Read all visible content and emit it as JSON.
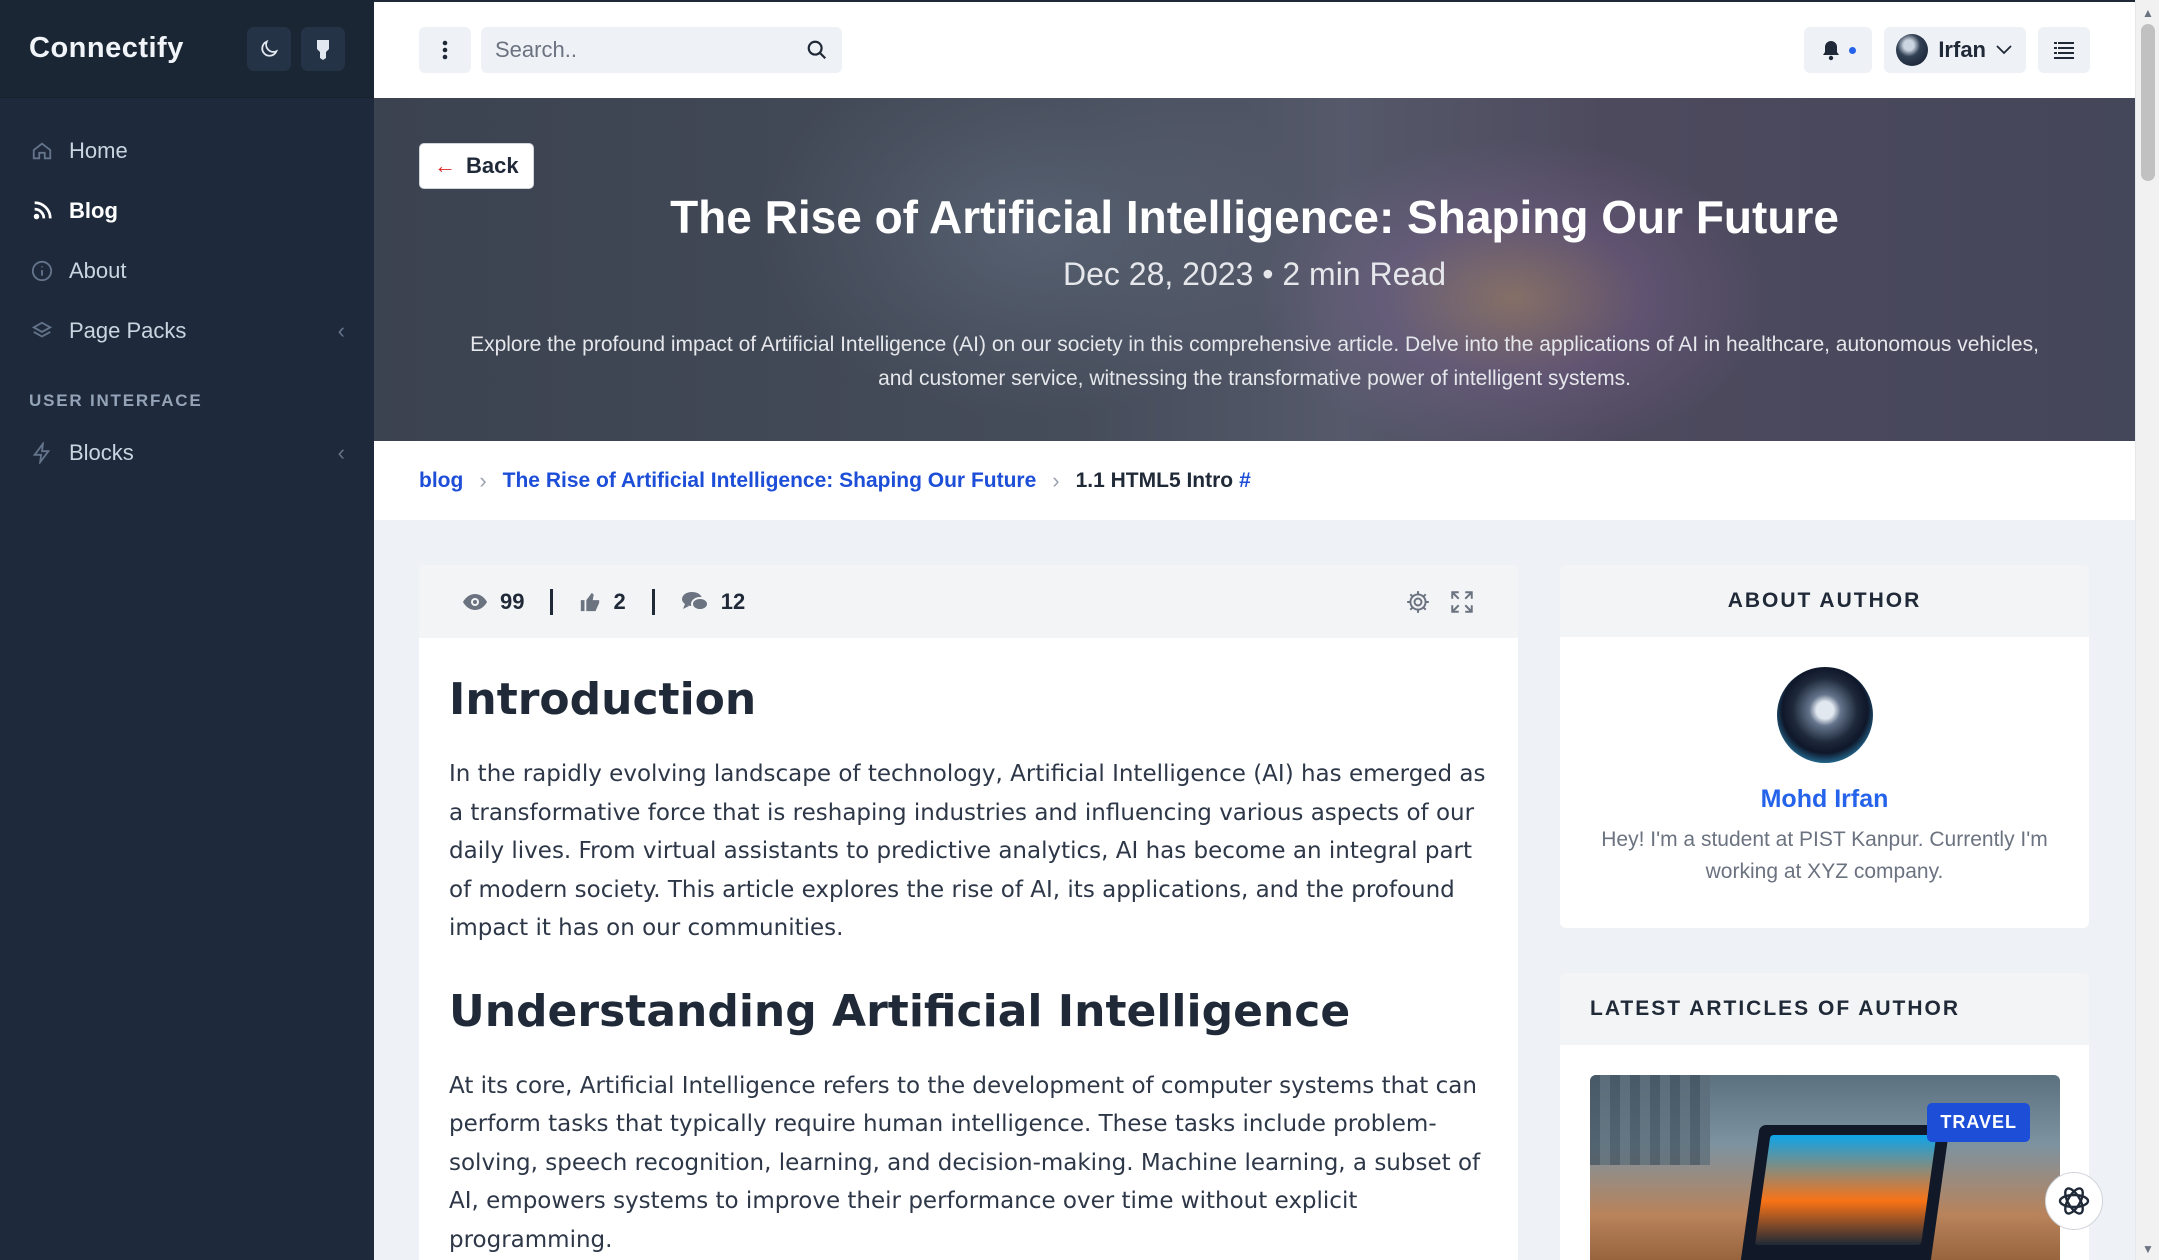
{
  "sidebar": {
    "brand": "Connectify",
    "items": [
      {
        "label": "Home",
        "icon": "home-icon"
      },
      {
        "label": "Blog",
        "icon": "blog-icon"
      },
      {
        "label": "About",
        "icon": "info-icon"
      },
      {
        "label": "Page Packs",
        "icon": "layers-icon"
      }
    ],
    "section_label": "USER INTERFACE",
    "section_items": [
      {
        "label": "Blocks",
        "icon": "bolt-icon"
      }
    ]
  },
  "topbar": {
    "search_placeholder": "Search..",
    "user_name": "Irfan"
  },
  "hero": {
    "back_label": "Back",
    "title": "The Rise of Artificial Intelligence: Shaping Our Future",
    "meta": "Dec 28, 2023 • 2 min Read",
    "description": "Explore the profound impact of Artificial Intelligence (AI) on our society in this comprehensive article. Delve into the applications of AI in healthcare, autonomous vehicles, and customer service, witnessing the transformative power of intelligent systems."
  },
  "breadcrumb": {
    "root": "blog",
    "article": "The Rise of Artificial Intelligence: Shaping Our Future",
    "current": "1.1 HTML5 Intro",
    "anchor": "#"
  },
  "article": {
    "views": "99",
    "likes": "2",
    "comments": "12",
    "h1": "Introduction",
    "p1": "In the rapidly evolving landscape of technology, Artificial Intelligence (AI) has emerged as a transformative force that is reshaping industries and influencing various aspects of our daily lives. From virtual assistants to predictive analytics, AI has become an integral part of modern society. This article explores the rise of AI, its applications, and the profound impact it has on our communities.",
    "h2": "Understanding Artificial Intelligence",
    "p2": "At its core, Artificial Intelligence refers to the development of computer systems that can perform tasks that typically require human intelligence. These tasks include problem-solving, speech recognition, learning, and decision-making. Machine learning, a subset of AI, empowers systems to improve their performance over time without explicit programming."
  },
  "author": {
    "heading": "ABOUT AUTHOR",
    "name": "Mohd Irfan",
    "bio": "Hey! I'm a student at PIST Kanpur. Currently I'm working at XYZ company."
  },
  "latest": {
    "heading": "LATEST ARTICLES OF AUTHOR",
    "badge": "TRAVEL"
  },
  "colors": {
    "sidebar_bg": "#1e2a3b",
    "accent": "#2563eb",
    "back_arrow": "#dc2626"
  }
}
